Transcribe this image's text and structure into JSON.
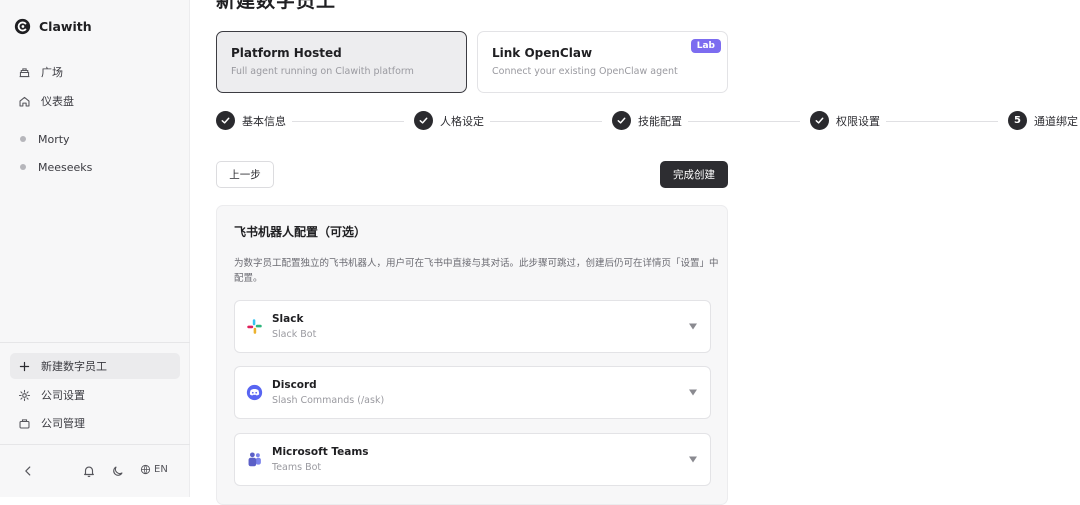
{
  "app": {
    "name": "Clawith"
  },
  "sidebar": {
    "nav": [
      {
        "label": "广场",
        "icon": "plaza-icon"
      },
      {
        "label": "仪表盘",
        "icon": "home-icon"
      }
    ],
    "agents": [
      {
        "label": "Morty"
      },
      {
        "label": "Meeseeks"
      }
    ],
    "bottom_nav": [
      {
        "label": "新建数字员工",
        "icon": "plus-icon"
      },
      {
        "label": "公司设置",
        "icon": "gear-icon"
      },
      {
        "label": "公司管理",
        "icon": "briefcase-icon"
      }
    ],
    "footer": {
      "lang": "EN"
    }
  },
  "main": {
    "title": "新建数字员工",
    "modes": [
      {
        "title": "Platform Hosted",
        "desc": "Full agent running on Clawith platform",
        "selected": true
      },
      {
        "title": "Link OpenClaw",
        "desc": "Connect your existing OpenClaw agent",
        "badge": "Lab"
      }
    ],
    "steps": [
      {
        "label": "基本信息",
        "state": "done"
      },
      {
        "label": "人格设定",
        "state": "done"
      },
      {
        "label": "技能配置",
        "state": "done"
      },
      {
        "label": "权限设置",
        "state": "done"
      },
      {
        "label": "通道绑定",
        "state": "current",
        "number": "5"
      }
    ],
    "buttons": {
      "prev": "上一步",
      "finish": "完成创建"
    },
    "panel": {
      "title": "飞书机器人配置（可选）",
      "desc": "为数字员工配置独立的飞书机器人，用户可在飞书中直接与其对话。此步骤可跳过，创建后仍可在详情页「设置」中配置。",
      "channels": [
        {
          "name": "Slack",
          "sub": "Slack Bot",
          "icon": "slack-icon"
        },
        {
          "name": "Discord",
          "sub": "Slash Commands (/ask)",
          "icon": "discord-icon"
        },
        {
          "name": "Microsoft Teams",
          "sub": "Teams Bot",
          "icon": "teams-icon"
        }
      ]
    }
  },
  "colors": {
    "accent_dark": "#2d2d31",
    "lab_badge": "#7c6cf0",
    "discord": "#5865f2",
    "teams": "#5b5fc7"
  }
}
